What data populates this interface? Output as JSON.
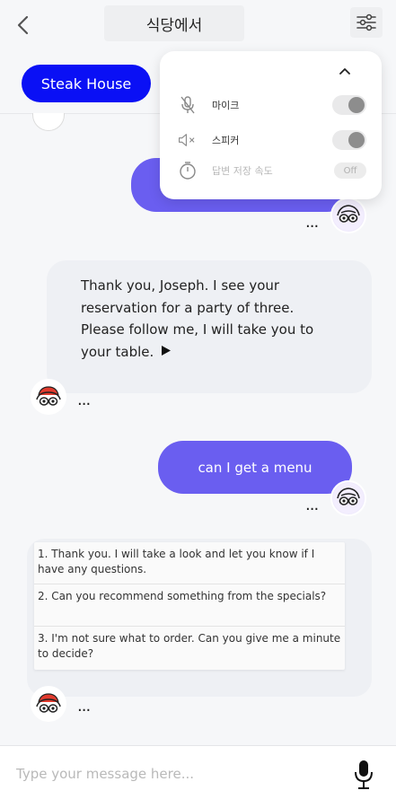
{
  "header": {
    "title": "식당에서"
  },
  "chip": {
    "label": "Steak House"
  },
  "settings_panel": {
    "mic_label": "마이크",
    "speaker_label": "스피커",
    "speed_label": "답변 저장 속도",
    "speed_value": "Off"
  },
  "messages": {
    "bot_1": "Thank you, Joseph. I see your reservation for a party of three. Please follow me, I will take you to your table.",
    "user_2": "can I get a menu",
    "options": [
      "1. Thank you. I will take a look and let you know if I have any questions.",
      "2. Can you recommend something from the specials?",
      "3. I'm not sure what to order. Can you give me a minute to decide?"
    ]
  },
  "composer": {
    "placeholder": "Type your message here..."
  },
  "more_glyph": "...",
  "colors": {
    "accent": "#0a10f5",
    "user_bubble": "#6a5ef0",
    "bot_bubble": "#eef0f4"
  }
}
